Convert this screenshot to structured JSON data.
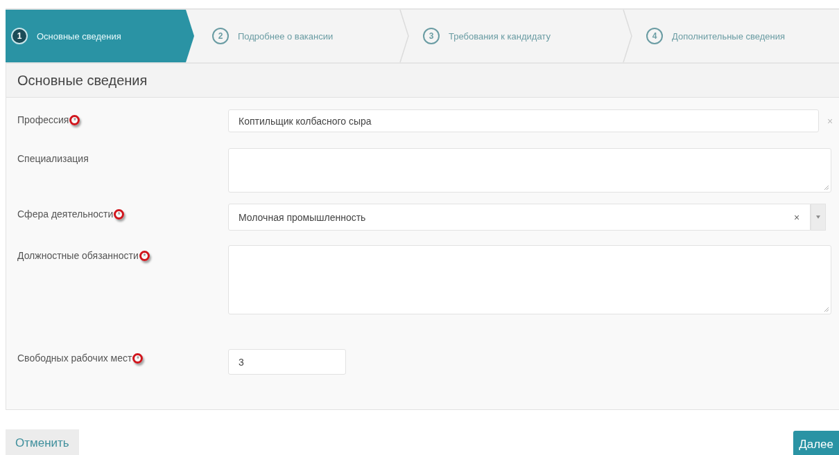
{
  "steps": [
    {
      "number": "1",
      "label": "Основные сведения",
      "selected": true
    },
    {
      "number": "2",
      "label": "Подробнее о вакансии",
      "selected": false
    },
    {
      "number": "3",
      "label": "Требования к кандидату",
      "selected": false
    },
    {
      "number": "4",
      "label": "Дополнительные сведения",
      "selected": false
    }
  ],
  "panel": {
    "title": "Основные сведения",
    "fields": [
      {
        "kind": "text",
        "label": "Профессия",
        "required_mark": "*",
        "value": "Коптильщик колбасного сыра",
        "clear": "×"
      },
      {
        "kind": "textarea",
        "label": "Специализация"
      },
      {
        "kind": "select",
        "label": "Сфера деятельности",
        "required_mark": "*",
        "value": "Молочная промышленность",
        "clear": "×"
      },
      {
        "kind": "longtext",
        "label": "Должностные обязанности",
        "required_mark": "*"
      },
      {
        "kind": "short",
        "label": "Свободных рабочих мест",
        "required_mark": "*",
        "value": "3"
      }
    ]
  },
  "buttons": {
    "cancel": "Отменить",
    "next": "Далее"
  }
}
